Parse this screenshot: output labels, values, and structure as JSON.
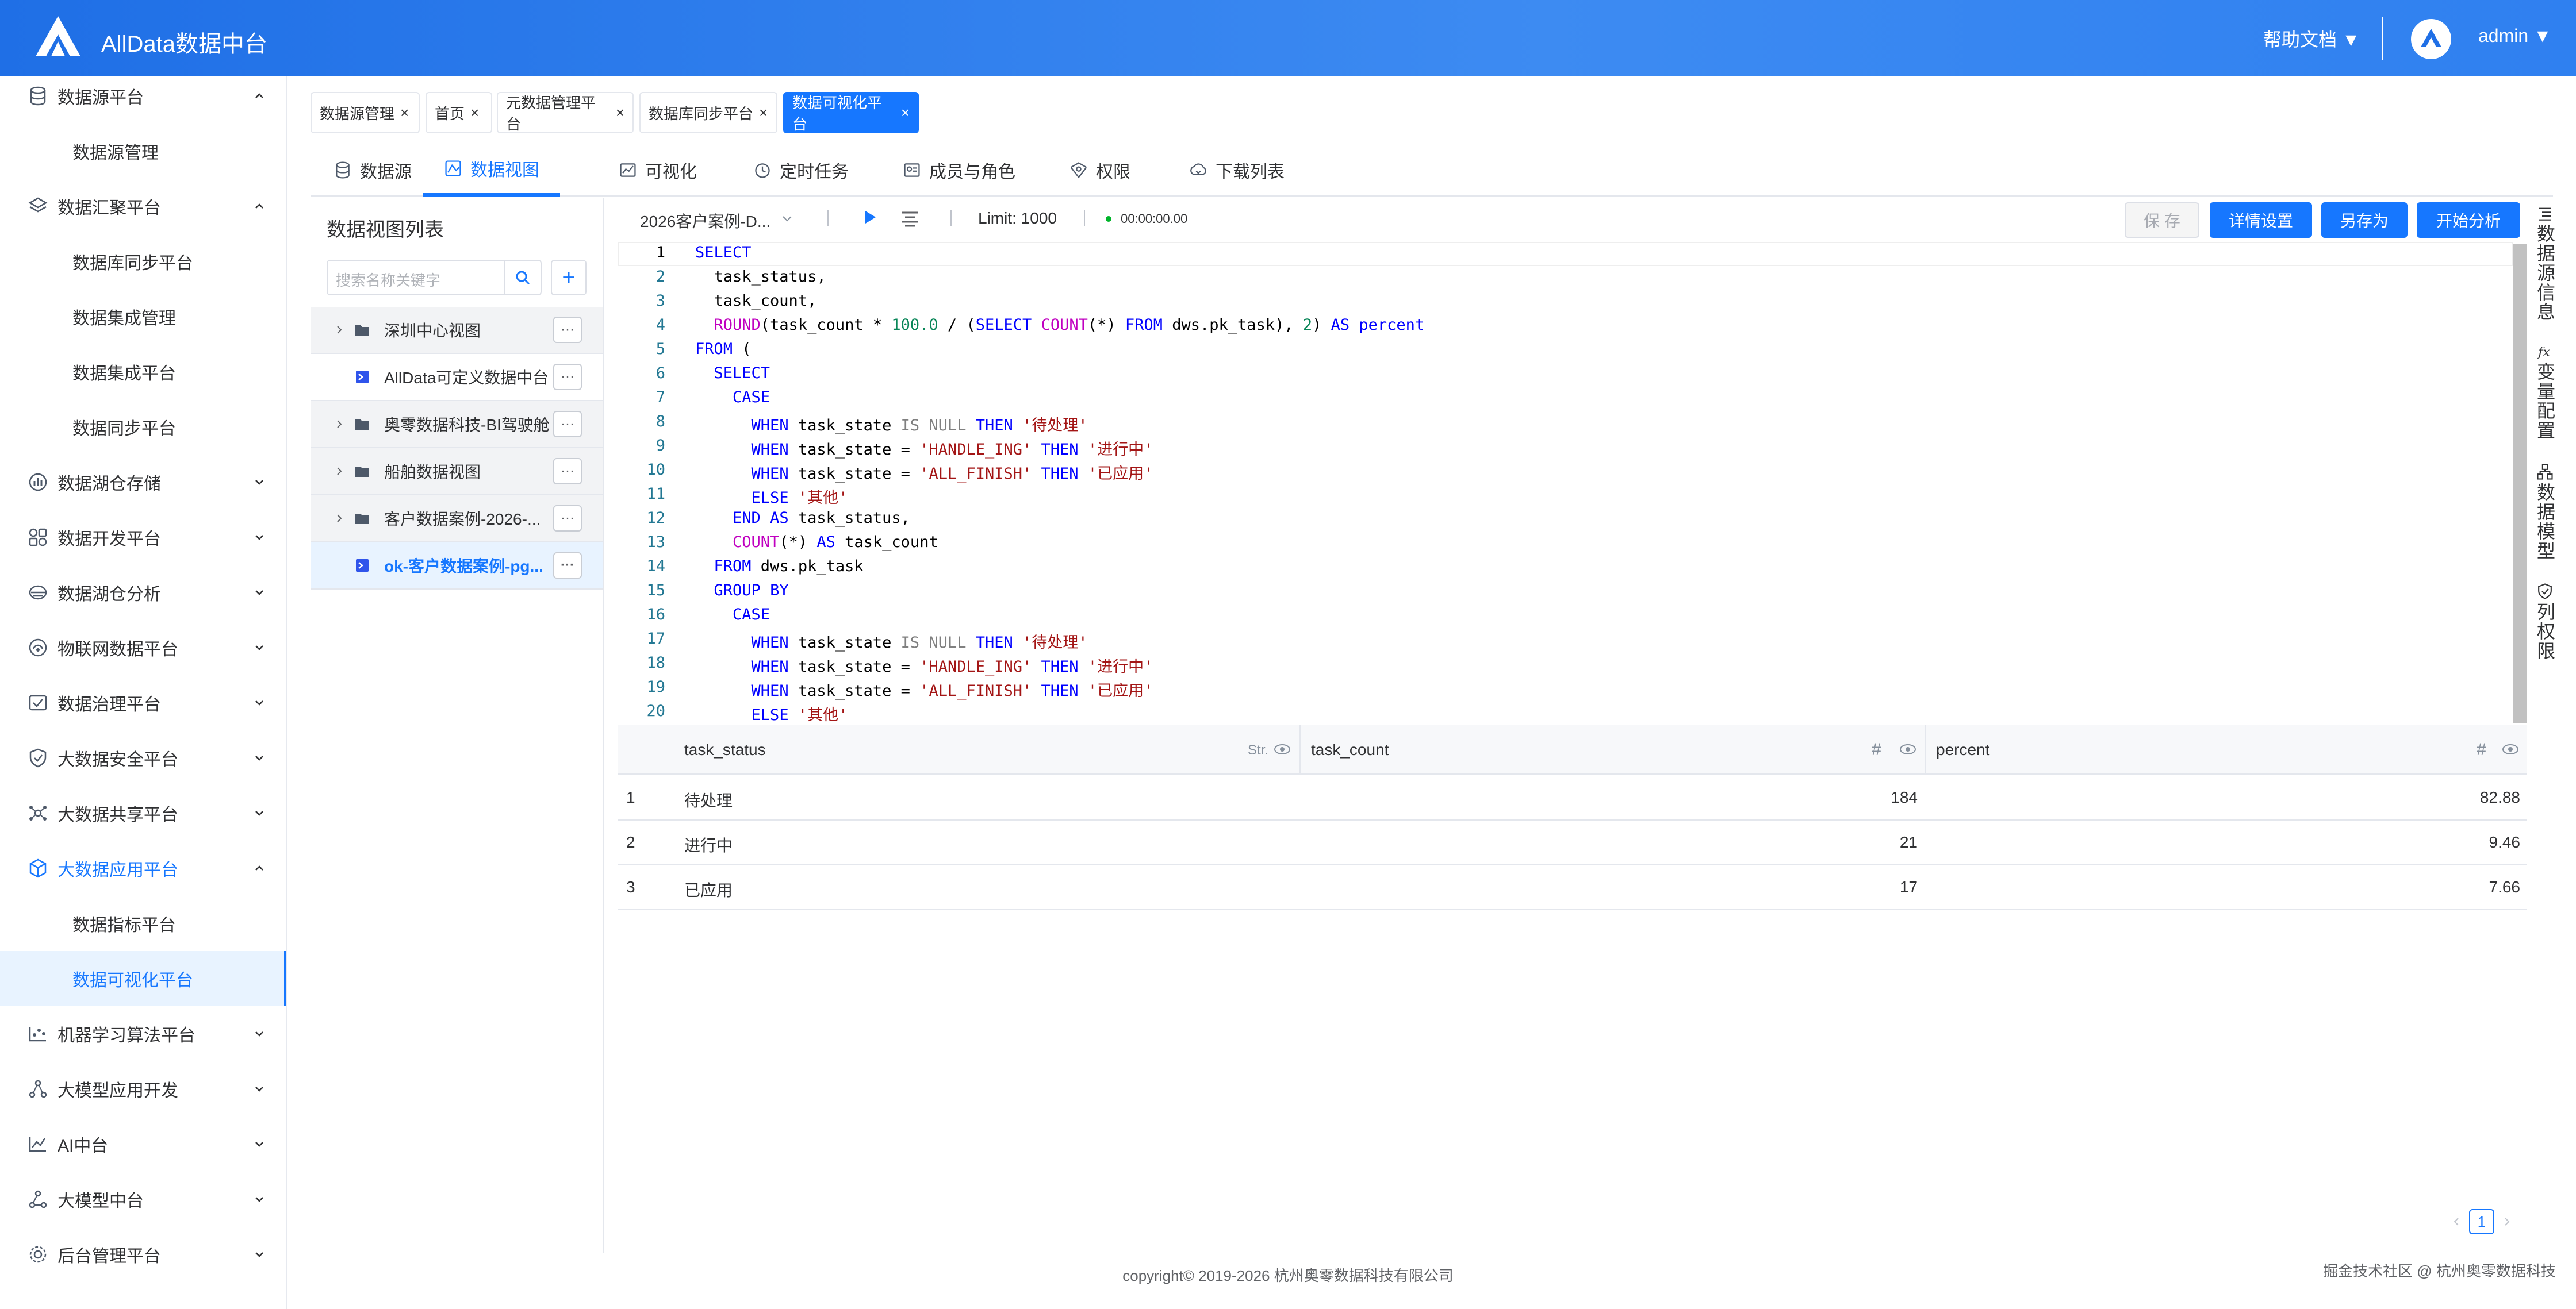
{
  "app": {
    "title": "AllData数据中台",
    "help": "帮助文档 ▼",
    "user": "admin ▼"
  },
  "sidebar": {
    "items": [
      {
        "label": "数据源平台",
        "icon": "database-icon",
        "expanded": true
      },
      {
        "label": "数据源管理",
        "sub": true
      },
      {
        "label": "数据汇聚平台",
        "icon": "layers-icon",
        "expanded": true
      },
      {
        "label": "数据库同步平台",
        "sub": true
      },
      {
        "label": "数据集成管理",
        "sub": true
      },
      {
        "label": "数据集成平台",
        "sub": true
      },
      {
        "label": "数据同步平台",
        "sub": true
      },
      {
        "label": "数据湖仓存储",
        "icon": "chart-icon"
      },
      {
        "label": "数据开发平台",
        "icon": "grid-icon"
      },
      {
        "label": "数据湖仓分析",
        "icon": "analysis-icon"
      },
      {
        "label": "物联网数据平台",
        "icon": "iot-icon"
      },
      {
        "label": "数据治理平台",
        "icon": "governance-icon"
      },
      {
        "label": "大数据安全平台",
        "icon": "shield-icon"
      },
      {
        "label": "大数据共享平台",
        "icon": "share-icon"
      },
      {
        "label": "大数据应用平台",
        "icon": "cube-icon",
        "expanded": true,
        "active": true
      },
      {
        "label": "数据指标平台",
        "sub": true
      },
      {
        "label": "数据可视化平台",
        "sub": true,
        "active": true
      },
      {
        "label": "机器学习算法平台",
        "icon": "ml-icon"
      },
      {
        "label": "大模型应用开发",
        "icon": "model-dev-icon"
      },
      {
        "label": "AI中台",
        "icon": "ai-icon"
      },
      {
        "label": "大模型中台",
        "icon": "llm-icon"
      },
      {
        "label": "后台管理平台",
        "icon": "settings-icon"
      }
    ]
  },
  "tags": [
    {
      "label": "数据源管理"
    },
    {
      "label": "首页"
    },
    {
      "label": "元数据管理平台"
    },
    {
      "label": "数据库同步平台"
    },
    {
      "label": "数据可视化平台",
      "active": true
    }
  ],
  "tabs": [
    {
      "label": "数据源",
      "icon": "database-icon"
    },
    {
      "label": "数据视图",
      "icon": "view-icon",
      "active": true
    },
    {
      "label": "可视化",
      "icon": "visual-icon"
    },
    {
      "label": "定时任务",
      "icon": "clock-icon"
    },
    {
      "label": "成员与角色",
      "icon": "members-icon"
    },
    {
      "label": "权限",
      "icon": "permission-icon"
    },
    {
      "label": "下载列表",
      "icon": "download-icon"
    }
  ],
  "view_list": {
    "title": "数据视图列表",
    "search_placeholder": "搜索名称关键字",
    "nodes": [
      {
        "label": "深圳中心视图",
        "type": "folder"
      },
      {
        "label": "AllData可定义数据中台",
        "type": "view"
      },
      {
        "label": "奥零数据科技-BI驾驶舱",
        "type": "folder"
      },
      {
        "label": "船舶数据视图",
        "type": "folder"
      },
      {
        "label": "客户数据案例-2026-...",
        "type": "folder"
      },
      {
        "label": "ok-客户数据案例-pg...",
        "type": "view",
        "selected": true
      }
    ],
    "more_label": "···"
  },
  "editor": {
    "datasource": "2026客户案例-D...",
    "limit": "Limit: 1000",
    "time": "00:00:00.00",
    "buttons": {
      "save": "保 存",
      "details": "详情设置",
      "save_as": "另存为",
      "analyze": "开始分析"
    },
    "code_lines": [
      "SELECT",
      "  task_status,",
      "  task_count,",
      "  ROUND(task_count * 100.0 / (SELECT COUNT(*) FROM dws.pk_task), 2) AS percent",
      "FROM (",
      "  SELECT",
      "    CASE",
      "      WHEN task_state IS NULL THEN '待处理'",
      "      WHEN task_state = 'HANDLE_ING' THEN '进行中'",
      "      WHEN task_state = 'ALL_FINISH' THEN '已应用'",
      "      ELSE '其他'",
      "    END AS task_status,",
      "    COUNT(*) AS task_count",
      "  FROM dws.pk_task",
      "  GROUP BY",
      "    CASE",
      "      WHEN task_state IS NULL THEN '待处理'",
      "      WHEN task_state = 'HANDLE_ING' THEN '进行中'",
      "      WHEN task_state = 'ALL_FINISH' THEN '已应用'",
      "      ELSE '其他'"
    ]
  },
  "right_panel": [
    {
      "label": "数据源信息",
      "icon": "catalog-icon"
    },
    {
      "label": "变量配置",
      "icon": "fx-icon"
    },
    {
      "label": "数据模型",
      "icon": "model-icon"
    },
    {
      "label": "列权限",
      "icon": "column-permission-icon"
    }
  ],
  "results": {
    "columns": [
      {
        "name": "task_status",
        "type": "Str."
      },
      {
        "name": "task_count",
        "type": "#"
      },
      {
        "name": "percent",
        "type": "#"
      }
    ],
    "rows": [
      {
        "idx": "1",
        "task_status": "待处理",
        "task_count": "184",
        "percent": "82.88"
      },
      {
        "idx": "2",
        "task_status": "进行中",
        "task_count": "21",
        "percent": "9.46"
      },
      {
        "idx": "3",
        "task_status": "已应用",
        "task_count": "17",
        "percent": "7.66"
      }
    ]
  },
  "pager": {
    "page": "1"
  },
  "footer": {
    "copyright": "copyright© 2019-2026 杭州奥零数据科技有限公司",
    "right": "掘金技术社区 @ 杭州奥零数据科技"
  },
  "colors": {
    "primary": "#1677ff",
    "header_start": "#1f6fe6",
    "header_end": "#3d8bf2"
  }
}
